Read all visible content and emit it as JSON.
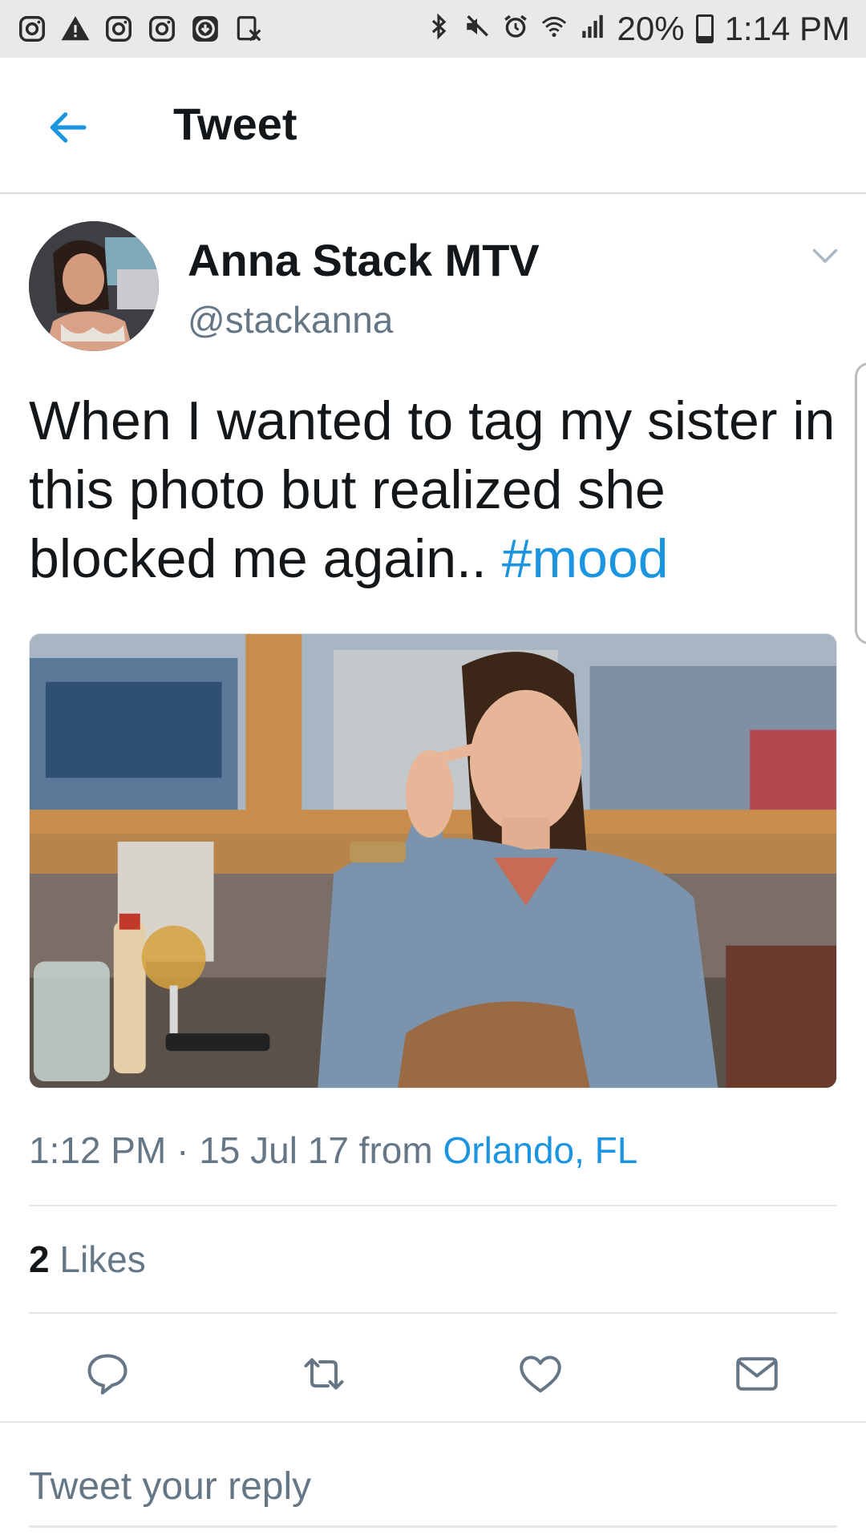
{
  "status_bar": {
    "left_icons": [
      "instagram-icon",
      "warning-icon",
      "instagram-icon",
      "instagram-icon",
      "download-icon",
      "screenshot-icon"
    ],
    "right_icons": [
      "bluetooth-icon",
      "mute-icon",
      "alarm-icon",
      "wifi-icon",
      "signal-icon"
    ],
    "battery": "20%",
    "time": "1:14 PM"
  },
  "header": {
    "back_icon": "arrow-left-icon",
    "title": "Tweet"
  },
  "tweet": {
    "author_name": "Anna Stack MTV",
    "author_handle": "@stackanna",
    "text": "When I wanted to tag my sister in this photo but realized she blocked me again.. ",
    "hashtag": "#mood",
    "time": "1:12 PM",
    "date_sep": " · ",
    "date": "15 Jul 17",
    "from_label": " from ",
    "location": "Orlando, FL",
    "likes_count": "2",
    "likes_label": " Likes"
  },
  "actions": {
    "reply_icon": "reply-icon",
    "retweet_icon": "retweet-icon",
    "like_icon": "heart-icon",
    "dm_icon": "envelope-icon"
  },
  "reply": {
    "placeholder": "Tweet your reply"
  },
  "colors": {
    "accent": "#1b95e0",
    "text": "#14171a",
    "secondary": "#657786",
    "divider": "#e1e8ed",
    "status_bar_bg": "#e8e9eb"
  }
}
